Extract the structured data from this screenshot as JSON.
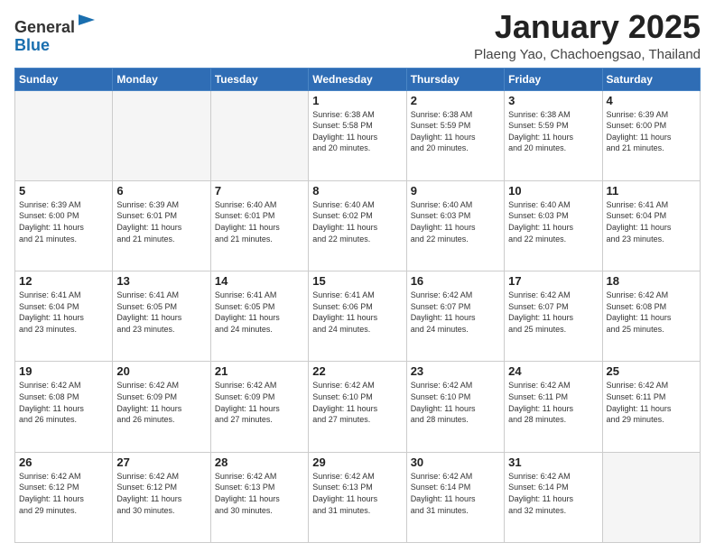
{
  "header": {
    "logo_general": "General",
    "logo_blue": "Blue",
    "title": "January 2025",
    "location": "Plaeng Yao, Chachoengsao, Thailand"
  },
  "weekdays": [
    "Sunday",
    "Monday",
    "Tuesday",
    "Wednesday",
    "Thursday",
    "Friday",
    "Saturday"
  ],
  "weeks": [
    [
      {
        "day": "",
        "info": ""
      },
      {
        "day": "",
        "info": ""
      },
      {
        "day": "",
        "info": ""
      },
      {
        "day": "1",
        "info": "Sunrise: 6:38 AM\nSunset: 5:58 PM\nDaylight: 11 hours\nand 20 minutes."
      },
      {
        "day": "2",
        "info": "Sunrise: 6:38 AM\nSunset: 5:59 PM\nDaylight: 11 hours\nand 20 minutes."
      },
      {
        "day": "3",
        "info": "Sunrise: 6:38 AM\nSunset: 5:59 PM\nDaylight: 11 hours\nand 20 minutes."
      },
      {
        "day": "4",
        "info": "Sunrise: 6:39 AM\nSunset: 6:00 PM\nDaylight: 11 hours\nand 21 minutes."
      }
    ],
    [
      {
        "day": "5",
        "info": "Sunrise: 6:39 AM\nSunset: 6:00 PM\nDaylight: 11 hours\nand 21 minutes."
      },
      {
        "day": "6",
        "info": "Sunrise: 6:39 AM\nSunset: 6:01 PM\nDaylight: 11 hours\nand 21 minutes."
      },
      {
        "day": "7",
        "info": "Sunrise: 6:40 AM\nSunset: 6:01 PM\nDaylight: 11 hours\nand 21 minutes."
      },
      {
        "day": "8",
        "info": "Sunrise: 6:40 AM\nSunset: 6:02 PM\nDaylight: 11 hours\nand 22 minutes."
      },
      {
        "day": "9",
        "info": "Sunrise: 6:40 AM\nSunset: 6:03 PM\nDaylight: 11 hours\nand 22 minutes."
      },
      {
        "day": "10",
        "info": "Sunrise: 6:40 AM\nSunset: 6:03 PM\nDaylight: 11 hours\nand 22 minutes."
      },
      {
        "day": "11",
        "info": "Sunrise: 6:41 AM\nSunset: 6:04 PM\nDaylight: 11 hours\nand 23 minutes."
      }
    ],
    [
      {
        "day": "12",
        "info": "Sunrise: 6:41 AM\nSunset: 6:04 PM\nDaylight: 11 hours\nand 23 minutes."
      },
      {
        "day": "13",
        "info": "Sunrise: 6:41 AM\nSunset: 6:05 PM\nDaylight: 11 hours\nand 23 minutes."
      },
      {
        "day": "14",
        "info": "Sunrise: 6:41 AM\nSunset: 6:05 PM\nDaylight: 11 hours\nand 24 minutes."
      },
      {
        "day": "15",
        "info": "Sunrise: 6:41 AM\nSunset: 6:06 PM\nDaylight: 11 hours\nand 24 minutes."
      },
      {
        "day": "16",
        "info": "Sunrise: 6:42 AM\nSunset: 6:07 PM\nDaylight: 11 hours\nand 24 minutes."
      },
      {
        "day": "17",
        "info": "Sunrise: 6:42 AM\nSunset: 6:07 PM\nDaylight: 11 hours\nand 25 minutes."
      },
      {
        "day": "18",
        "info": "Sunrise: 6:42 AM\nSunset: 6:08 PM\nDaylight: 11 hours\nand 25 minutes."
      }
    ],
    [
      {
        "day": "19",
        "info": "Sunrise: 6:42 AM\nSunset: 6:08 PM\nDaylight: 11 hours\nand 26 minutes."
      },
      {
        "day": "20",
        "info": "Sunrise: 6:42 AM\nSunset: 6:09 PM\nDaylight: 11 hours\nand 26 minutes."
      },
      {
        "day": "21",
        "info": "Sunrise: 6:42 AM\nSunset: 6:09 PM\nDaylight: 11 hours\nand 27 minutes."
      },
      {
        "day": "22",
        "info": "Sunrise: 6:42 AM\nSunset: 6:10 PM\nDaylight: 11 hours\nand 27 minutes."
      },
      {
        "day": "23",
        "info": "Sunrise: 6:42 AM\nSunset: 6:10 PM\nDaylight: 11 hours\nand 28 minutes."
      },
      {
        "day": "24",
        "info": "Sunrise: 6:42 AM\nSunset: 6:11 PM\nDaylight: 11 hours\nand 28 minutes."
      },
      {
        "day": "25",
        "info": "Sunrise: 6:42 AM\nSunset: 6:11 PM\nDaylight: 11 hours\nand 29 minutes."
      }
    ],
    [
      {
        "day": "26",
        "info": "Sunrise: 6:42 AM\nSunset: 6:12 PM\nDaylight: 11 hours\nand 29 minutes."
      },
      {
        "day": "27",
        "info": "Sunrise: 6:42 AM\nSunset: 6:12 PM\nDaylight: 11 hours\nand 30 minutes."
      },
      {
        "day": "28",
        "info": "Sunrise: 6:42 AM\nSunset: 6:13 PM\nDaylight: 11 hours\nand 30 minutes."
      },
      {
        "day": "29",
        "info": "Sunrise: 6:42 AM\nSunset: 6:13 PM\nDaylight: 11 hours\nand 31 minutes."
      },
      {
        "day": "30",
        "info": "Sunrise: 6:42 AM\nSunset: 6:14 PM\nDaylight: 11 hours\nand 31 minutes."
      },
      {
        "day": "31",
        "info": "Sunrise: 6:42 AM\nSunset: 6:14 PM\nDaylight: 11 hours\nand 32 minutes."
      },
      {
        "day": "",
        "info": ""
      }
    ]
  ]
}
